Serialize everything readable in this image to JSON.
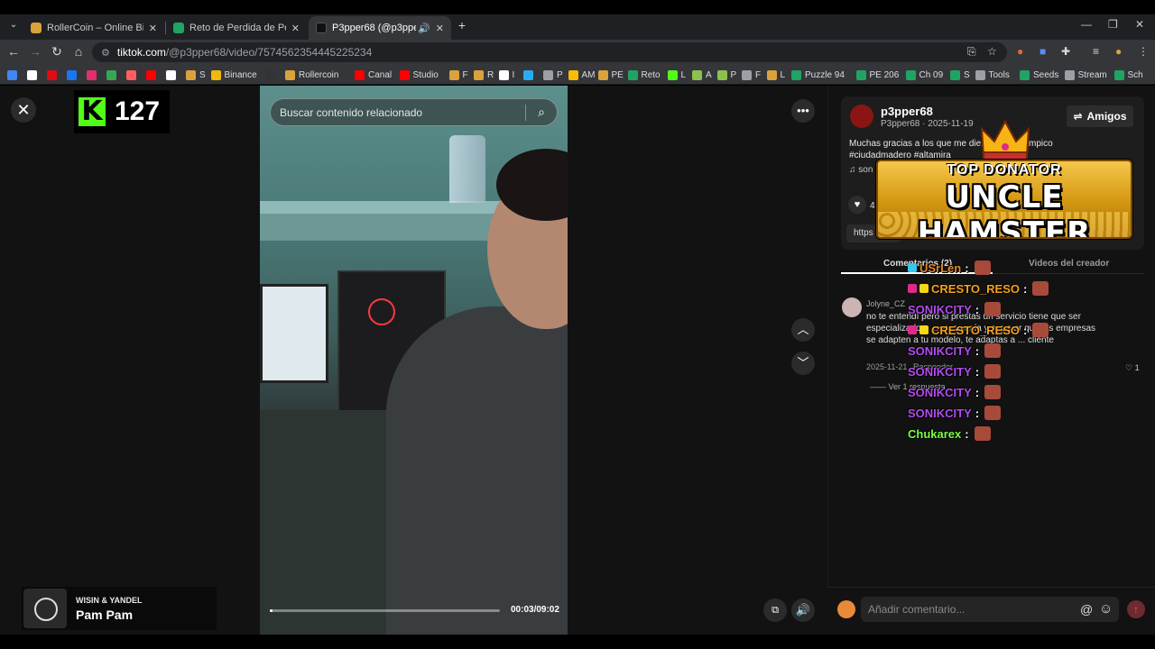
{
  "browser": {
    "tabs": [
      {
        "title": "RollerCoin – Online Bitcoin Mi",
        "color": "#d9a23a"
      },
      {
        "title": "Reto de Perdida de Peso - El M",
        "color": "#1fa463"
      },
      {
        "title": "P3pper68 (@p3pper68) | Tik",
        "color": "#111111"
      }
    ],
    "new_tab": "+",
    "url_host": "tiktok.com",
    "url_path": "/@p3pper68/video/7574562354445225234",
    "bookmarks": [
      {
        "label": "",
        "color": "#4285f4"
      },
      {
        "label": "",
        "color": "#ffffff"
      },
      {
        "label": "",
        "color": "#e50914"
      },
      {
        "label": "",
        "color": "#1877f2"
      },
      {
        "label": "",
        "color": "#e1306c"
      },
      {
        "label": "",
        "color": "#34a853"
      },
      {
        "label": "",
        "color": "#ff5f5f"
      },
      {
        "label": "",
        "color": "#ff0000"
      },
      {
        "label": "",
        "color": "#ffffff"
      },
      {
        "label": "S",
        "color": "#d9a23a"
      },
      {
        "label": "Binance",
        "color": "#f0b90b"
      },
      {
        "label": "",
        "color": "#333333"
      },
      {
        "label": "Rollercoin",
        "color": "#d9a23a"
      },
      {
        "label": "Canal",
        "color": "#ff0000"
      },
      {
        "label": "Studio",
        "color": "#ff0000"
      },
      {
        "label": "F",
        "color": "#d9a23a"
      },
      {
        "label": "R",
        "color": "#d9a23a"
      },
      {
        "label": "I",
        "color": "#ffffff"
      },
      {
        "label": "",
        "color": "#2aabee"
      },
      {
        "label": "P",
        "color": "#9aa0a6"
      },
      {
        "label": "AM",
        "color": "#fbbc04"
      },
      {
        "label": "PE",
        "color": "#d9a23a"
      },
      {
        "label": "Reto",
        "color": "#1fa463"
      },
      {
        "label": "L",
        "color": "#53fc18"
      },
      {
        "label": "A",
        "color": "#8bc34a"
      },
      {
        "label": "P",
        "color": "#8bc34a"
      },
      {
        "label": "F",
        "color": "#9aa0a6"
      },
      {
        "label": "L",
        "color": "#d9a23a"
      },
      {
        "label": "Puzzle 94",
        "color": "#1fa463"
      },
      {
        "label": "PE 206",
        "color": "#1fa463"
      },
      {
        "label": "Ch 09",
        "color": "#1fa463"
      },
      {
        "label": "S",
        "color": "#1fa463"
      },
      {
        "label": "Tools",
        "color": "#9aa0a6"
      },
      {
        "label": "Seeds",
        "color": "#1fa463"
      },
      {
        "label": "Stream",
        "color": "#9aa0a6"
      },
      {
        "label": "Sch",
        "color": "#1fa463"
      }
    ]
  },
  "kick": {
    "count": "127",
    "letter": "K"
  },
  "search": {
    "placeholder": "Buscar contenido relacionado"
  },
  "video": {
    "time": "00:03/09:02",
    "progress": 0.01
  },
  "music": {
    "artist": "WISIN & YANDEL",
    "song": "Pam Pam"
  },
  "creator": {
    "name": "p3pper68",
    "sub": "P3pper68 · 2025-11-19",
    "follow_label": "Amigos",
    "description": "Muchas gracias a los que me die... ...to... #tampico #ciudadmadero #altamira",
    "sound": "son",
    "likes": "4",
    "link": "https"
  },
  "tabs": {
    "comments": "Comentarios (2)",
    "creator_videos": "Videos del creador"
  },
  "comment": {
    "user": "Jolyne_CZ",
    "text": "no te entendí pero si prestas un servicio tiene que ser especializado... ...casa vacía y esperar que las empresas se adapten a tu modelo, te adaptas a ... cliente",
    "date": "2025-11-21",
    "reply": "Responder",
    "likes": "1",
    "more": "Ver 1 respuesta"
  },
  "donator": {
    "top": "TOP DONATOR",
    "name": "UNCLE HAMSTER"
  },
  "chat": [
    {
      "user": "USrLen",
      "color": "#e08a2a"
    },
    {
      "user": "CRESTO_RESO",
      "color": "#f7a21b"
    },
    {
      "user": "SONIKCITY",
      "color": "#b44cf0"
    },
    {
      "user": "CRESTO_RESO",
      "color": "#f7a21b"
    },
    {
      "user": "SONIKCITY",
      "color": "#b44cf0"
    },
    {
      "user": "SONIKCITY",
      "color": "#b44cf0"
    },
    {
      "user": "SONIKCITY",
      "color": "#b44cf0"
    },
    {
      "user": "SONIKCITY",
      "color": "#b44cf0"
    },
    {
      "user": "Chukarex",
      "color": "#7cfc4a"
    }
  ],
  "input": {
    "placeholder": "Añadir comentario..."
  }
}
